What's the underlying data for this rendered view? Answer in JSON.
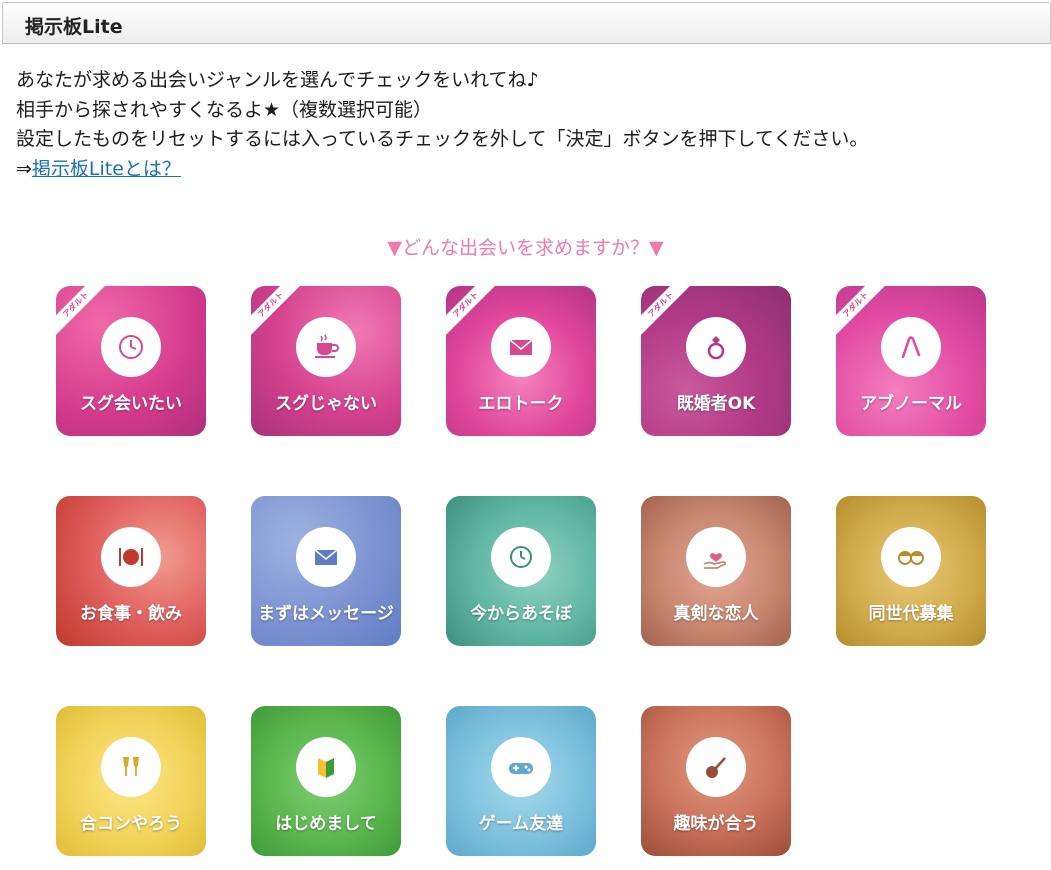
{
  "header": {
    "title": "掲示板Lite"
  },
  "intro": {
    "line1": "あなたが求める出会いジャンルを選んでチェックをいれてね♪",
    "line2": "相手から探されやすくなるよ★（複数選択可能）",
    "line3": "設定したものをリセットするには入っているチェックを外して「決定」ボタンを押下してください。",
    "arrow": "⇒",
    "link_text": "掲示板Liteとは？"
  },
  "heading": "▼どんな出会いを求めますか？▼",
  "badge_text": "アダルト",
  "tiles": [
    {
      "label": "スグ会いたい",
      "icon": "clock-icon",
      "adult": true
    },
    {
      "label": "スグじゃない",
      "icon": "coffee-cup-icon",
      "adult": true
    },
    {
      "label": "エロトーク",
      "icon": "envelope-icon",
      "adult": true
    },
    {
      "label": "既婚者OK",
      "icon": "ring-icon",
      "adult": true
    },
    {
      "label": "アブノーマル",
      "icon": "whip-icon",
      "adult": true
    },
    {
      "label": "お食事・飲み",
      "icon": "plate-cutlery-icon",
      "adult": false
    },
    {
      "label": "まずはメッセージ",
      "icon": "envelope-icon",
      "adult": false
    },
    {
      "label": "今からあそぼ",
      "icon": "watch-icon",
      "adult": false
    },
    {
      "label": "真剣な恋人",
      "icon": "heart-hand-icon",
      "adult": false
    },
    {
      "label": "同世代募集",
      "icon": "two-faces-icon",
      "adult": false
    },
    {
      "label": "合コンやろう",
      "icon": "champagne-glasses-icon",
      "adult": false
    },
    {
      "label": "はじめまして",
      "icon": "beginner-mark-icon",
      "adult": false
    },
    {
      "label": "ゲーム友達",
      "icon": "gamepad-icon",
      "adult": false
    },
    {
      "label": "趣味が合う",
      "icon": "guitar-icon",
      "adult": false
    }
  ]
}
